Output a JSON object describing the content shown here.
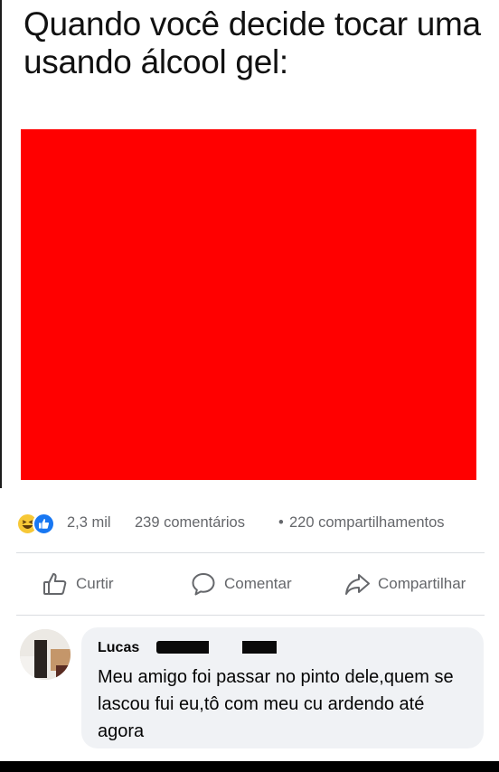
{
  "post": {
    "caption": "Quando você decide tocar uma usando álcool gel:",
    "image_color": "#ff0000"
  },
  "stats": {
    "reaction_icons": [
      "haha-icon",
      "like-icon"
    ],
    "reactions": "2,3 mil",
    "comments": "239 comentários",
    "separator": "•",
    "shares": "220 compartilhamentos"
  },
  "actions": {
    "like": "Curtir",
    "comment": "Comentar",
    "share": "Compartilhar"
  },
  "comment": {
    "author": "Lucas",
    "text": "Meu amigo foi passar no pinto dele,quem se lascou fui eu,tô com meu cu ardendo até agora"
  },
  "colors": {
    "accent": "#1877f2",
    "muted_text": "#65676b",
    "bubble": "#f0f2f5"
  }
}
